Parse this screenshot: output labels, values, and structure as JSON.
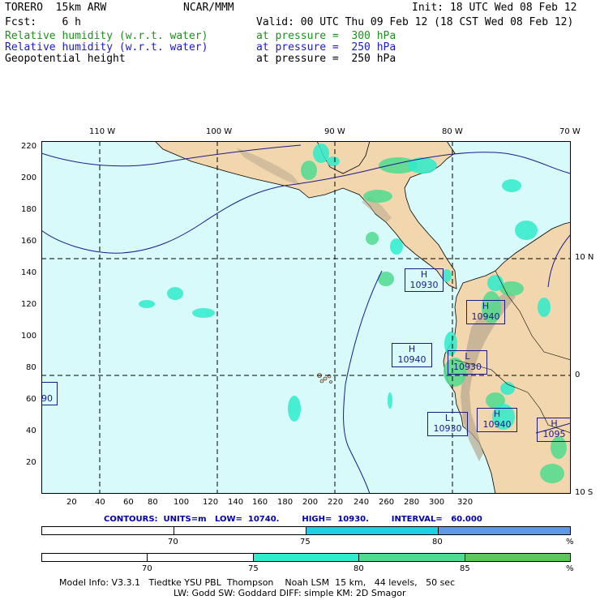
{
  "header": {
    "model": "TORERO  15km ARW",
    "org": "NCAR/MMM",
    "init": "Init: 18 UTC Wed 08 Feb 12",
    "fcst": "Fcst:    6 h",
    "valid": "Valid: 00 UTC Thu 09 Feb 12 (18 CST Wed 08 Feb 12)"
  },
  "fields": [
    {
      "name": "Relative humidity (w.r.t. water)",
      "level": "at pressure =  300 hPa",
      "color": "#1f8f1f"
    },
    {
      "name": "Relative humidity (w.r.t. water)",
      "level": "at pressure =  250 hPa",
      "color": "#1a1acc"
    },
    {
      "name": "Geopotential height",
      "level": "at pressure =  250 hPa",
      "color": "#000000"
    }
  ],
  "map": {
    "lon_labels": [
      "110 W",
      "100 W",
      "90 W",
      "80 W",
      "70 W"
    ],
    "lat_labels": [
      "10 N",
      "0",
      "10 S"
    ],
    "y_ticks": [
      "220",
      "200",
      "180",
      "160",
      "140",
      "120",
      "100",
      "80",
      "60",
      "40",
      "20"
    ],
    "x_ticks": [
      "20",
      "40",
      "60",
      "80",
      "100",
      "120",
      "140",
      "160",
      "180",
      "200",
      "220",
      "240",
      "260",
      "280",
      "300",
      "320"
    ],
    "ocean_color": "#d8fafa",
    "land_color": "#f2d7ae",
    "terrain_color": "#b8a890",
    "highlows": [
      {
        "letter": "H",
        "value": "10930"
      },
      {
        "letter": "H",
        "value": "10940"
      },
      {
        "letter": "H",
        "value": "10940"
      },
      {
        "letter": "L",
        "value": "10930"
      },
      {
        "letter": "L",
        "value": "10930"
      },
      {
        "letter": "H",
        "value": "10940"
      },
      {
        "letter": "H",
        "value": "1095"
      },
      {
        "letter": "",
        "value": "90"
      }
    ]
  },
  "contours_line": "CONTOURS:  UNITS=m   LOW=  10740.        HIGH=  10930.        INTERVAL=   60.000",
  "colorbar_250": {
    "labels": [
      "70",
      "75",
      "80",
      "%"
    ],
    "colors": [
      "#ffffff",
      "#ffffff",
      "#1ecfe6",
      "#5c9ae8"
    ]
  },
  "colorbar_300": {
    "labels": [
      "70",
      "75",
      "80",
      "85",
      "%"
    ],
    "colors": [
      "#ffffff",
      "#ffffff",
      "#2eeccc",
      "#4fdb90",
      "#5cc85c"
    ]
  },
  "footer": {
    "line1": "Model Info: V3.3.1   Tiedtke YSU PBL  Thompson    Noah LSM  15 km,   44 levels,   50 sec",
    "line2": "LW: Godd SW: Goddard DIFF: simple KM: 2D Smagor"
  }
}
